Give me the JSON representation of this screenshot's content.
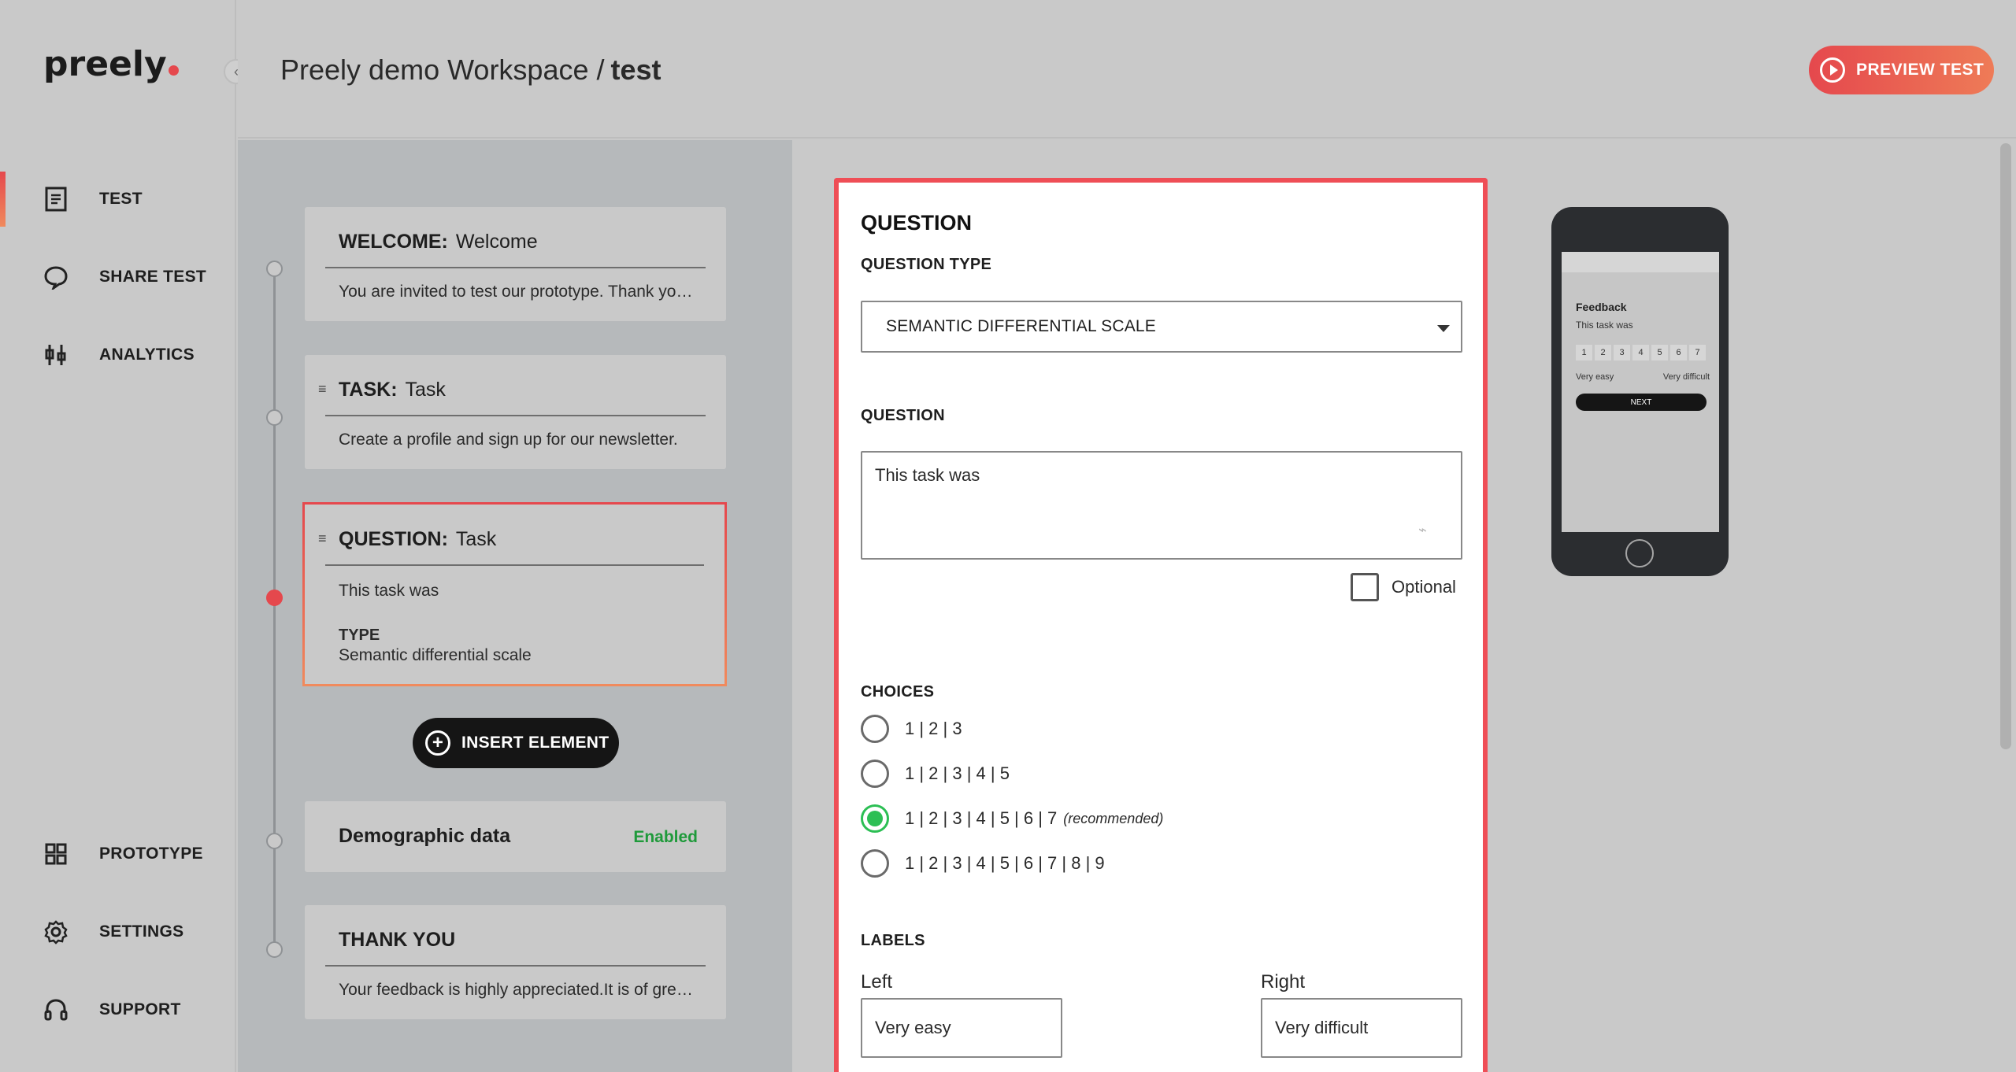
{
  "app": {
    "logo": "preely"
  },
  "sidebar": {
    "items": [
      {
        "label": "TEST",
        "icon": "document-icon"
      },
      {
        "label": "SHARE TEST",
        "icon": "speech-bubble-icon"
      },
      {
        "label": "ANALYTICS",
        "icon": "analytics-icon"
      },
      {
        "label": "PROTOTYPE",
        "icon": "grid-icon"
      },
      {
        "label": "SETTINGS",
        "icon": "gear-icon"
      },
      {
        "label": "SUPPORT",
        "icon": "headset-icon"
      }
    ],
    "accent": "#e5484d"
  },
  "header": {
    "workspace": "Preely demo Workspace /",
    "current": "test",
    "preview_label": "PREVIEW TEST"
  },
  "timeline": {
    "welcome": {
      "type": "WELCOME:",
      "title": "Welcome",
      "body": "You are invited to test our prototype. Thank you for participating in this test."
    },
    "task": {
      "type": "TASK:",
      "title": "Task",
      "body": "Create a profile and sign up for our newsletter."
    },
    "question": {
      "type": "QUESTION:",
      "title": "Task",
      "body": "This task was",
      "type_label": "TYPE",
      "type_value": "Semantic differential scale"
    },
    "insert_label": "INSERT ELEMENT",
    "demographic": {
      "title": "Demographic data",
      "status": "Enabled"
    },
    "thankyou": {
      "title": "THANK YOU",
      "body": "Your feedback is highly appreciated.It is of great value to us."
    }
  },
  "editor": {
    "heading": "QUESTION",
    "question_type_label": "QUESTION TYPE",
    "question_type_value": "SEMANTIC DIFFERENTIAL SCALE",
    "question_label": "QUESTION",
    "question_value": "This task was",
    "optional_label": "Optional",
    "choices_label": "CHOICES",
    "choices": [
      {
        "label": "1 | 2 | 3",
        "checked": false
      },
      {
        "label": "1 | 2 | 3 | 4 | 5",
        "checked": false
      },
      {
        "label": "1 | 2 | 3 | 4 | 5 | 6 | 7",
        "note": "(recommended)",
        "checked": true
      },
      {
        "label": "1 | 2 | 3 | 4 | 5 | 6 | 7 | 8 | 9",
        "checked": false
      }
    ],
    "labels_label": "LABELS",
    "left_label": "Left",
    "left_value": "Very easy",
    "right_label": "Right",
    "right_value": "Very difficult",
    "border_color": "#ef4e56"
  },
  "phone_preview": {
    "title": "Feedback",
    "question": "This task was",
    "scale": [
      "1",
      "2",
      "3",
      "4",
      "5",
      "6",
      "7"
    ],
    "left": "Very easy",
    "right": "Very difficult",
    "next": "NEXT"
  }
}
